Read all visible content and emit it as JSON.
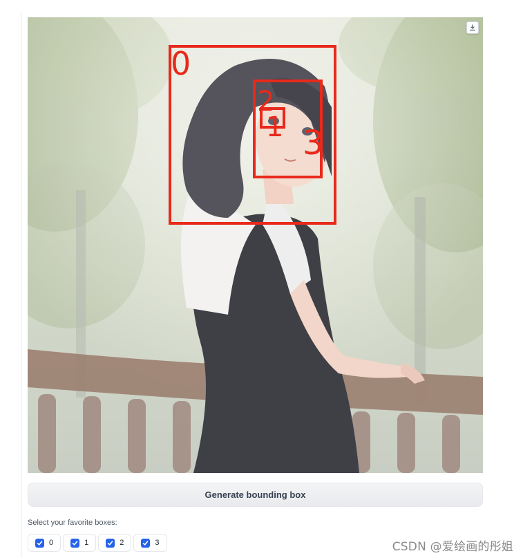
{
  "image": {
    "alt": "Watercolor anime girl with bounding boxes",
    "box_labels": [
      "0",
      "2",
      "1",
      "3"
    ],
    "box_color": "#e8291c",
    "download_icon": "download-icon"
  },
  "generate_button": {
    "label": "Generate bounding box"
  },
  "checkbox_group": {
    "label": "Select your favorite boxes:",
    "options": [
      {
        "label": "0",
        "checked": true
      },
      {
        "label": "1",
        "checked": true
      },
      {
        "label": "2",
        "checked": true
      },
      {
        "label": "3",
        "checked": true
      }
    ],
    "accent_color": "#2563eb"
  },
  "watermark": {
    "text": "CSDN @爱绘画的彤姐"
  }
}
